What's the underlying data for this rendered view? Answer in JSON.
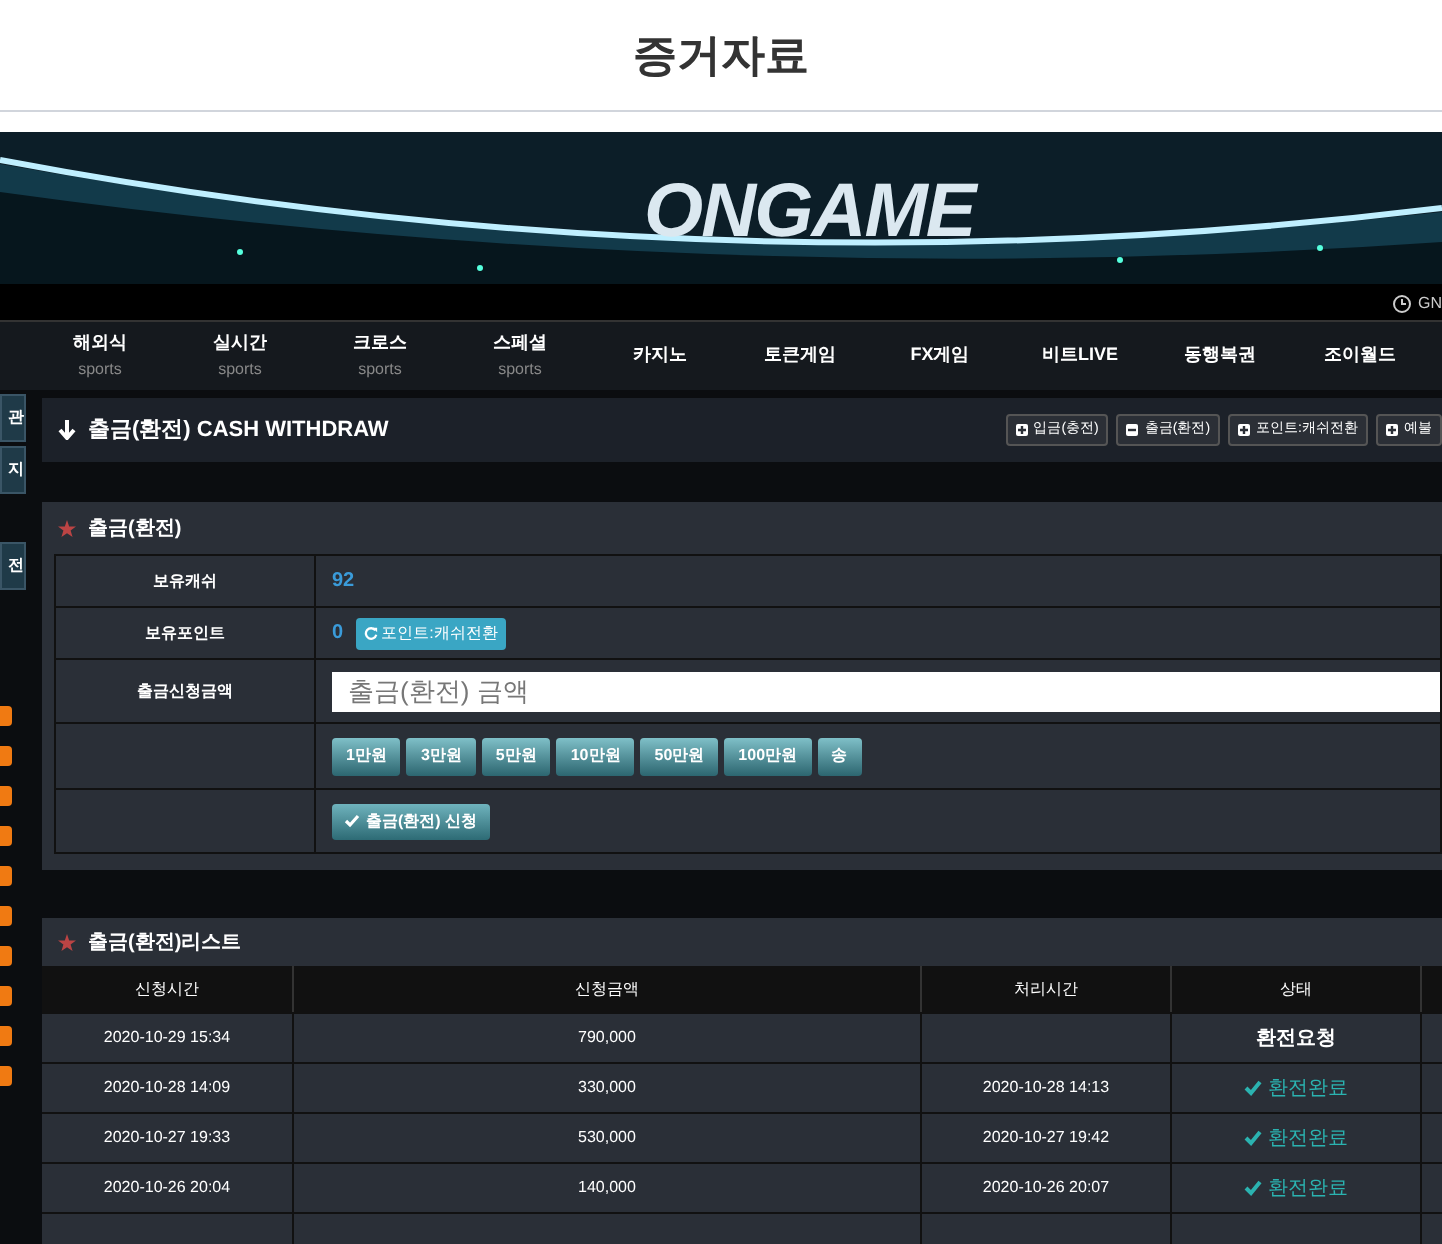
{
  "page_title": "증거자료",
  "banner": {
    "logo": "ONGAME",
    "corner_text": "GN"
  },
  "nav": [
    {
      "label": "해외식",
      "sub": "sports"
    },
    {
      "label": "실시간",
      "sub": "sports"
    },
    {
      "label": "크로스",
      "sub": "sports"
    },
    {
      "label": "스페셜",
      "sub": "sports"
    },
    {
      "label": "카지노"
    },
    {
      "label": "토큰게임"
    },
    {
      "label": "FX게임"
    },
    {
      "label": "비트LIVE"
    },
    {
      "label": "동행복권"
    },
    {
      "label": "조이월드"
    }
  ],
  "sidebar": {
    "items": [
      "관",
      "지",
      "전"
    ]
  },
  "header": {
    "title": "출금(환전) CASH WITHDRAW",
    "buttons": [
      {
        "label": "입금(충전)",
        "kind": "plus"
      },
      {
        "label": "출금(환전)",
        "kind": "minus"
      },
      {
        "label": "포인트:캐쉬전환",
        "kind": "plus"
      },
      {
        "label": "예불",
        "kind": "plus"
      }
    ]
  },
  "form": {
    "title": "출금(환전)",
    "cash_label": "보유캐쉬",
    "cash": "92",
    "points_label": "보유포인트",
    "points": "0",
    "convert_button": "포인트:캐쉬전환",
    "amount_label": "출금신청금액",
    "amount_placeholder": "출금(환전) 금액",
    "amount_buttons": [
      "1만원",
      "3만원",
      "5만원",
      "10만원",
      "50만원",
      "100만원",
      "송"
    ],
    "submit": "출금(환전) 신청"
  },
  "list": {
    "title": "출금(환전)리스트",
    "columns": [
      "신청시간",
      "신청금액",
      "처리시간",
      "상태"
    ],
    "rows": [
      {
        "requested": "2020-10-29 15:34",
        "amount": "790,000",
        "processed": "",
        "status": "환전요청",
        "kind": "request"
      },
      {
        "requested": "2020-10-28 14:09",
        "amount": "330,000",
        "processed": "2020-10-28 14:13",
        "status": "환전완료",
        "kind": "done"
      },
      {
        "requested": "2020-10-27 19:33",
        "amount": "530,000",
        "processed": "2020-10-27 19:42",
        "status": "환전완료",
        "kind": "done"
      },
      {
        "requested": "2020-10-26 20:04",
        "amount": "140,000",
        "processed": "2020-10-26 20:07",
        "status": "환전완료",
        "kind": "done"
      }
    ]
  }
}
